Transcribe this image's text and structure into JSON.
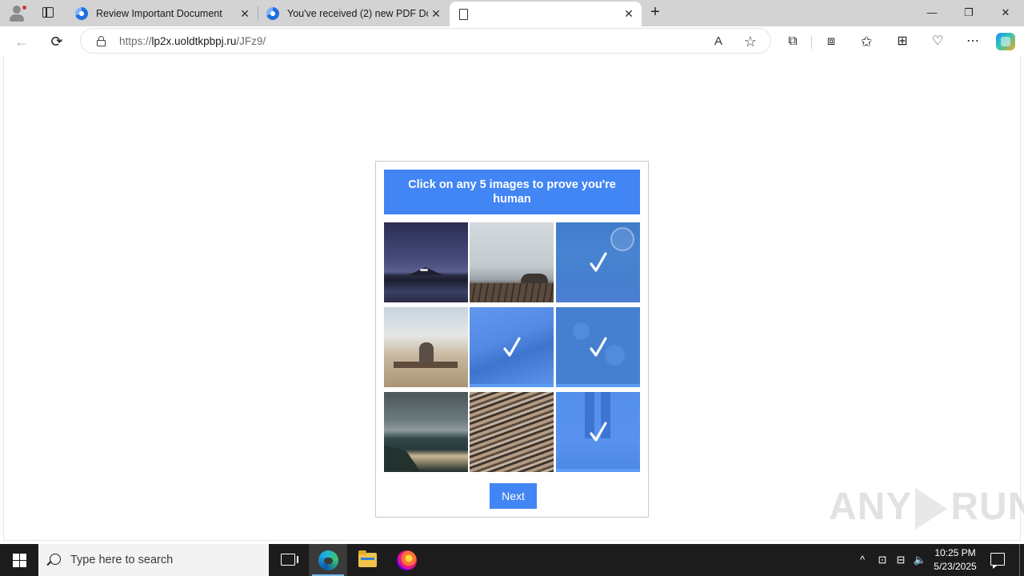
{
  "browser": {
    "tabs": [
      {
        "title": "Review Important Document",
        "close": "✕"
      },
      {
        "title": "You've received (2) new PDF Doc",
        "close": "✕"
      },
      {
        "title": "",
        "close": "✕"
      }
    ],
    "new_tab": "+",
    "window_controls": {
      "minimize": "—",
      "restore": "❐",
      "close": "✕"
    },
    "url": {
      "prefix": "https://",
      "host": "lp2x.uoldtkpbpj.ru",
      "path": "/JFz9/"
    },
    "icons": {
      "back": "←",
      "refresh": "⟳",
      "read_aloud": "A",
      "favorite": "☆",
      "extensions": "⧉",
      "split": "⧈",
      "favorites": "✩",
      "collections": "⊞",
      "performance": "♡",
      "more": "⋯"
    }
  },
  "captcha": {
    "instruction": "Click on any 5 images to prove you're human",
    "tiles": [
      {
        "name": "night-lake",
        "selected": false
      },
      {
        "name": "foggy-pier",
        "selected": false
      },
      {
        "name": "forest-railway",
        "selected": true
      },
      {
        "name": "bench-field",
        "selected": false
      },
      {
        "name": "woman-portrait",
        "selected": true
      },
      {
        "name": "succulents",
        "selected": true
      },
      {
        "name": "stormy-beach",
        "selected": false
      },
      {
        "name": "dry-grass",
        "selected": false
      },
      {
        "name": "legs-standing",
        "selected": true
      }
    ],
    "next_label": "Next",
    "accent_color": "#4285f4"
  },
  "watermark": {
    "left": "ANY",
    "right": "RUN"
  },
  "taskbar": {
    "search_placeholder": "Type here to search",
    "time": "10:25 PM",
    "date": "5/23/2025",
    "tray": {
      "chevron": "^",
      "meet": "⊡",
      "network": "⊟",
      "volume": "🔈"
    }
  }
}
